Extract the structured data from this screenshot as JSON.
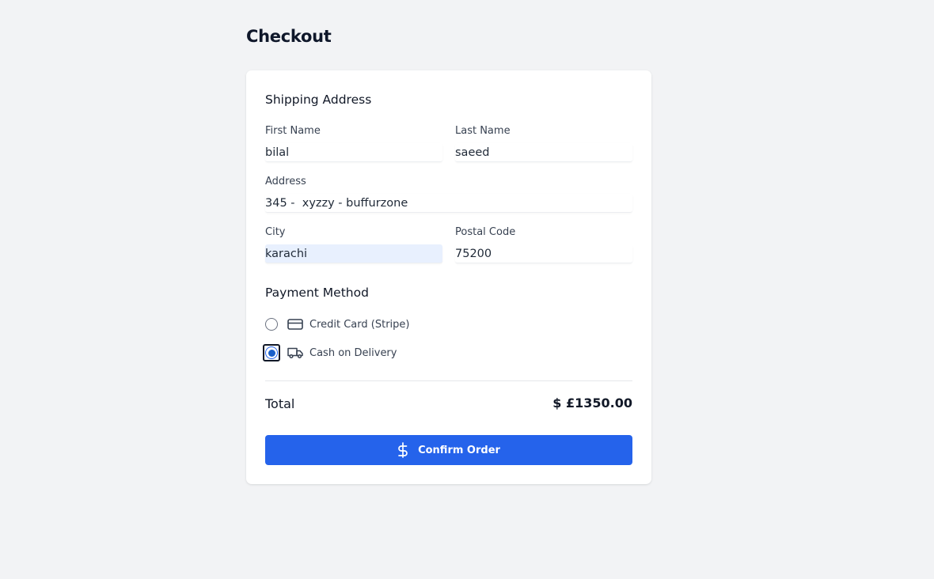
{
  "page": {
    "title": "Checkout"
  },
  "shipping": {
    "title": "Shipping Address",
    "first_name": {
      "label": "First Name",
      "value": "bilal"
    },
    "last_name": {
      "label": "Last Name",
      "value": "saeed"
    },
    "address": {
      "label": "Address",
      "value": "345 -  xyzzy - buffurzone"
    },
    "city": {
      "label": "City",
      "value": "karachi"
    },
    "postal_code": {
      "label": "Postal Code",
      "value": "75200"
    }
  },
  "payment": {
    "title": "Payment Method",
    "options": [
      {
        "label": "Credit Card (Stripe)",
        "icon": "credit-card-icon",
        "selected": false
      },
      {
        "label": "Cash on Delivery",
        "icon": "truck-icon",
        "selected": true
      }
    ]
  },
  "summary": {
    "total_label": "Total",
    "total_value": "$ £1350.00"
  },
  "actions": {
    "confirm_label": "Confirm Order",
    "confirm_icon": "dollar-sign-icon"
  },
  "colors": {
    "primary": "#2563eb",
    "background": "#f2f3f5",
    "card": "#ffffff",
    "autofill": "#e8f0fe"
  }
}
